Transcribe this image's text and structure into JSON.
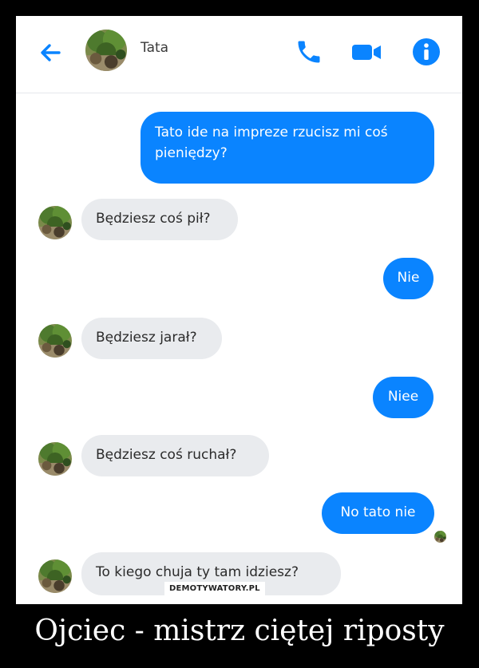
{
  "header": {
    "contact_name": "Tata",
    "icons": [
      "back-arrow-icon",
      "avatar",
      "phone-icon",
      "video-camera-icon",
      "info-icon"
    ]
  },
  "messages": [
    {
      "direction": "outgoing",
      "text": "Tato ide na impreze rzucisz mi coś pieniędzy?"
    },
    {
      "direction": "incoming",
      "text": "Będziesz coś pił?"
    },
    {
      "direction": "outgoing",
      "text": "Nie"
    },
    {
      "direction": "incoming",
      "text": "Będziesz jarał?"
    },
    {
      "direction": "outgoing",
      "text": "Niee"
    },
    {
      "direction": "incoming",
      "text": "Będziesz coś ruchał?"
    },
    {
      "direction": "outgoing",
      "text": "No tato nie"
    },
    {
      "direction": "incoming",
      "text": "To kiego chuja ty tam idziesz?"
    }
  ],
  "watermark": "DEMOTYWATORY.PL",
  "caption": "Ojciec - mistrz ciętej riposty",
  "colors": {
    "accent": "#0a84ff",
    "incoming_bubble": "#e9ebee",
    "frame_background": "#000000"
  }
}
